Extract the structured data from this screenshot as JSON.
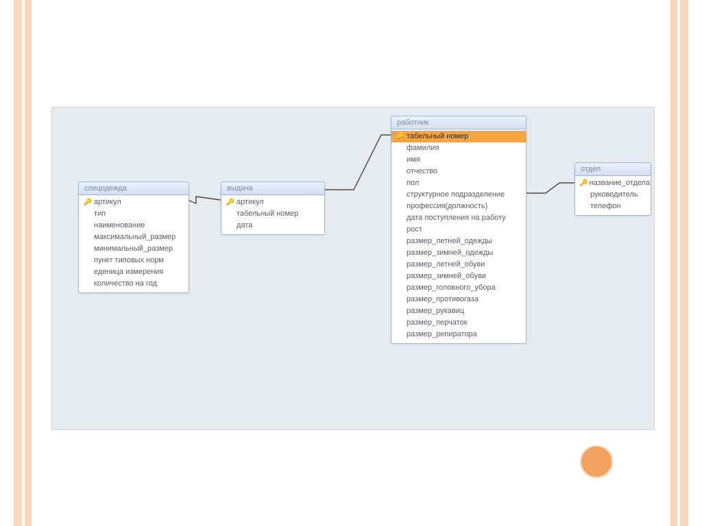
{
  "tables": [
    {
      "title": "спецодежда",
      "fields": [
        {
          "key": true,
          "name": "артикул",
          "selected": false
        },
        {
          "key": false,
          "name": "тип",
          "selected": false
        },
        {
          "key": false,
          "name": "наименование",
          "selected": false
        },
        {
          "key": false,
          "name": "максимальный_размер",
          "selected": false
        },
        {
          "key": false,
          "name": "минимальный_размер",
          "selected": false
        },
        {
          "key": false,
          "name": "пункт типовых норм",
          "selected": false
        },
        {
          "key": false,
          "name": "еденица измерения",
          "selected": false
        },
        {
          "key": false,
          "name": "количество на год",
          "selected": false
        }
      ]
    },
    {
      "title": "выдача",
      "fields": [
        {
          "key": true,
          "name": "артикул",
          "selected": false
        },
        {
          "key": false,
          "name": "табельный номер",
          "selected": false
        },
        {
          "key": false,
          "name": "дата",
          "selected": false
        }
      ]
    },
    {
      "title": "работник",
      "fields": [
        {
          "key": true,
          "name": "табельный номер",
          "selected": true
        },
        {
          "key": false,
          "name": "фамилия",
          "selected": false
        },
        {
          "key": false,
          "name": "имя",
          "selected": false
        },
        {
          "key": false,
          "name": "отчество",
          "selected": false
        },
        {
          "key": false,
          "name": "пол",
          "selected": false
        },
        {
          "key": false,
          "name": "структурное подразделение",
          "selected": false
        },
        {
          "key": false,
          "name": "профессия(должность)",
          "selected": false
        },
        {
          "key": false,
          "name": "дата поступления на работу",
          "selected": false
        },
        {
          "key": false,
          "name": "рост",
          "selected": false
        },
        {
          "key": false,
          "name": "размер_летней_одежды",
          "selected": false
        },
        {
          "key": false,
          "name": "размер_зимней_одежды",
          "selected": false
        },
        {
          "key": false,
          "name": "размер_летней_обуви",
          "selected": false
        },
        {
          "key": false,
          "name": "размер_зимней_обуви",
          "selected": false
        },
        {
          "key": false,
          "name": "размер_головного_убора",
          "selected": false
        },
        {
          "key": false,
          "name": "размер_противогаза",
          "selected": false
        },
        {
          "key": false,
          "name": "размер_рукавиц",
          "selected": false
        },
        {
          "key": false,
          "name": "размер_перчаток",
          "selected": false
        },
        {
          "key": false,
          "name": "размер_репиратора",
          "selected": false
        }
      ]
    },
    {
      "title": "отдел",
      "fields": [
        {
          "key": true,
          "name": "название_отдела",
          "selected": false
        },
        {
          "key": false,
          "name": "руководитель",
          "selected": false
        },
        {
          "key": false,
          "name": "телефон",
          "selected": false
        }
      ]
    }
  ],
  "colors": {
    "accent": "#f2a15f",
    "bar": "#fbd6b8",
    "canvas": "#e5ebee",
    "tableBorder": "#9fb4d6",
    "selectedRow": "#f6a443"
  }
}
